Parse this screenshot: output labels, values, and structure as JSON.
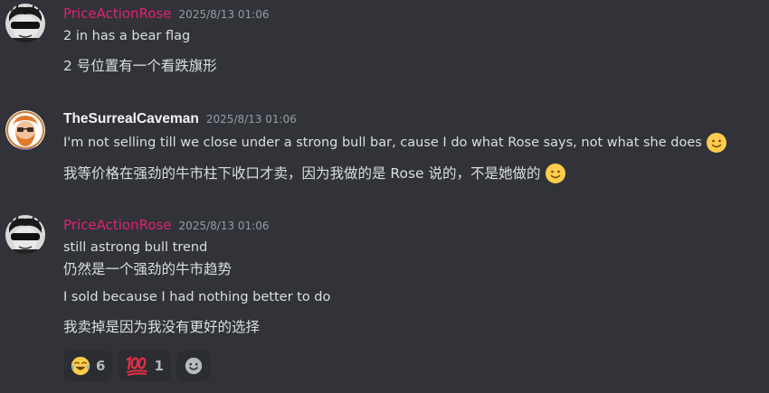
{
  "messages": [
    {
      "username": "PriceActionRose",
      "timestamp": "2025/8/13 01:06",
      "lines": [
        "2 in has a bear flag",
        "2 号位置有一个看跌旗形"
      ]
    },
    {
      "username": "TheSurrealCaveman",
      "timestamp": "2025/8/13 01:06",
      "lines": [
        "I'm not selling till we close under a strong bull bar, cause I do what Rose says, not what she does",
        "我等价格在强劲的牛市柱下收口才卖，因为我做的是 Rose 说的，不是她做的"
      ]
    },
    {
      "username": "PriceActionRose",
      "timestamp": "2025/8/13 01:06",
      "lines": [
        "still astrong bull trend",
        "仍然是一个强劲的牛市趋势",
        "I sold because I had nothing better to do",
        "我卖掉是因为我没有更好的选择"
      ]
    }
  ],
  "reactions": [
    {
      "emoji": "joy-emoji",
      "count": "6"
    },
    {
      "emoji": "hundred-emoji",
      "count": "1"
    }
  ],
  "colors": {
    "background": "#313338",
    "rose_name": "#e0226e",
    "text": "#dbdee1",
    "timestamp": "#949ba4"
  }
}
